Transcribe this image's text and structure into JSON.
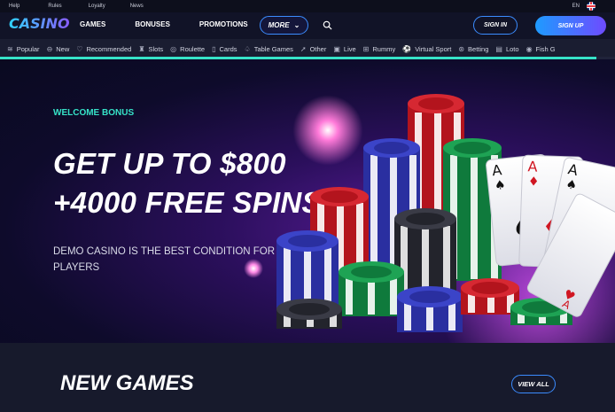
{
  "util": {
    "links": [
      "Help",
      "Rules",
      "Loyalty",
      "News"
    ],
    "lang": "EN"
  },
  "header": {
    "logo": "CASINO",
    "nav": [
      "GAMES",
      "BONUSES",
      "PROMOTIONS"
    ],
    "more_label": "MORE",
    "signin_label": "SIGN IN",
    "signup_label": "SIGN UP"
  },
  "categories": [
    {
      "label": "Popular",
      "icon": "layers-icon"
    },
    {
      "label": "New",
      "icon": "new-icon"
    },
    {
      "label": "Recommended",
      "icon": "heart-icon"
    },
    {
      "label": "Slots",
      "icon": "slots-icon"
    },
    {
      "label": "Roulette",
      "icon": "roulette-icon"
    },
    {
      "label": "Cards",
      "icon": "cards-icon"
    },
    {
      "label": "Table Games",
      "icon": "spade-icon"
    },
    {
      "label": "Other",
      "icon": "rocket-icon"
    },
    {
      "label": "Live",
      "icon": "live-icon"
    },
    {
      "label": "Rummy",
      "icon": "rummy-icon"
    },
    {
      "label": "Virtual Sport",
      "icon": "ball-icon"
    },
    {
      "label": "Betting",
      "icon": "betting-icon"
    },
    {
      "label": "Loto",
      "icon": "loto-icon"
    },
    {
      "label": "Fish G",
      "icon": "fish-icon"
    }
  ],
  "hero": {
    "label": "WELCOME BONUS",
    "headline1": "GET UP TO $800",
    "headline2": "+4000 FREE SPINS",
    "sub": "DEMO CASINO IS THE BEST CONDITION FOR PLAYERS",
    "progress_fraction": 0.97
  },
  "games": {
    "title": "NEW GAMES",
    "view_all": "VIEW ALL"
  },
  "colors": {
    "accent": "#36e3c8",
    "primary": "#3b8cff",
    "background": "#171a2c"
  }
}
